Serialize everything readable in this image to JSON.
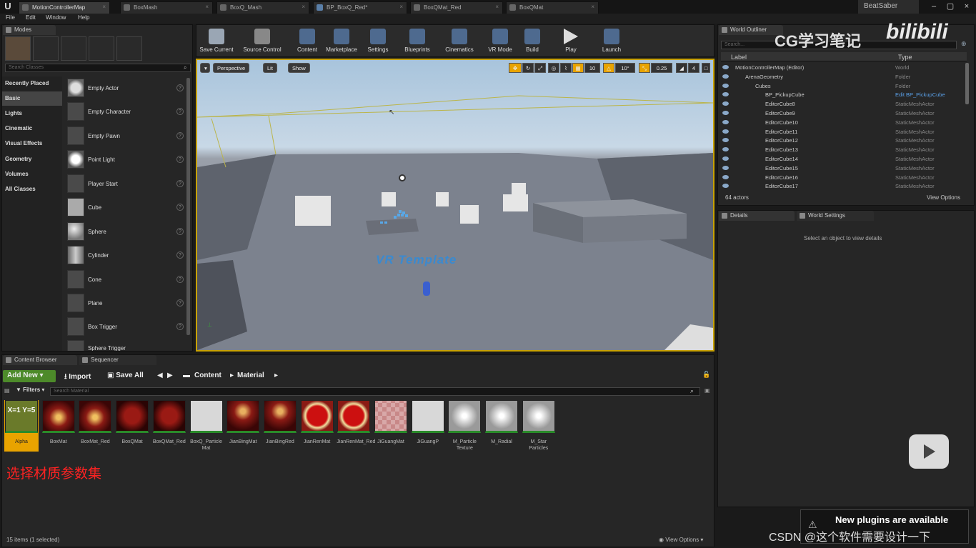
{
  "titlebar": {
    "tabs": [
      "MotionControllerMap",
      "BoxMash",
      "BoxQ_Mash",
      "BP_BoxQ_Red*",
      "BoxQMat_Red",
      "BoxQMat"
    ],
    "project": "BeatSaber"
  },
  "menu": [
    "File",
    "Edit",
    "Window",
    "Help"
  ],
  "modes": {
    "tab": "Modes",
    "search_placeholder": "Search Classes",
    "categories": [
      "Recently Placed",
      "Basic",
      "Lights",
      "Cinematic",
      "Visual Effects",
      "Geometry",
      "Volumes",
      "All Classes"
    ],
    "items": [
      "Empty Actor",
      "Empty Character",
      "Empty Pawn",
      "Point Light",
      "Player Start",
      "Cube",
      "Sphere",
      "Cylinder",
      "Cone",
      "Plane",
      "Box Trigger",
      "Sphere Trigger"
    ]
  },
  "toolbar": [
    "Save Current",
    "Source Control",
    "Content",
    "Marketplace",
    "Settings",
    "Blueprints",
    "Cinematics",
    "VR Mode",
    "Build",
    "Play",
    "Launch"
  ],
  "viewport": {
    "perspective": "Perspective",
    "lit": "Lit",
    "show": "Show",
    "grid": "10",
    "rot": "10°",
    "scale": "0.25",
    "cam": "4",
    "scene_text": "VR Template"
  },
  "outliner": {
    "tab": "World Outliner",
    "search_placeholder": "Search...",
    "col_label": "Label",
    "col_type": "Type",
    "rows": [
      {
        "label": "MotionControllerMap (Editor)",
        "type": "World",
        "indent": 0
      },
      {
        "label": "ArenaGeometry",
        "type": "Folder",
        "indent": 1
      },
      {
        "label": "Cubes",
        "type": "Folder",
        "indent": 2
      },
      {
        "label": "BP_PickupCube",
        "type": "Edit BP_PickupCube",
        "indent": 3
      },
      {
        "label": "EditorCube8",
        "type": "StaticMeshActor",
        "indent": 3
      },
      {
        "label": "EditorCube9",
        "type": "StaticMeshActor",
        "indent": 3
      },
      {
        "label": "EditorCube10",
        "type": "StaticMeshActor",
        "indent": 3
      },
      {
        "label": "EditorCube11",
        "type": "StaticMeshActor",
        "indent": 3
      },
      {
        "label": "EditorCube12",
        "type": "StaticMeshActor",
        "indent": 3
      },
      {
        "label": "EditorCube13",
        "type": "StaticMeshActor",
        "indent": 3
      },
      {
        "label": "EditorCube14",
        "type": "StaticMeshActor",
        "indent": 3
      },
      {
        "label": "EditorCube15",
        "type": "StaticMeshActor",
        "indent": 3
      },
      {
        "label": "EditorCube16",
        "type": "StaticMeshActor",
        "indent": 3
      },
      {
        "label": "EditorCube17",
        "type": "StaticMeshActor",
        "indent": 3
      }
    ],
    "count": "64 actors",
    "view_options": "View Options"
  },
  "details": {
    "tab": "Details",
    "tab2": "World Settings",
    "empty": "Select an object to view details"
  },
  "content_browser": {
    "tab": "Content Browser",
    "tab2": "Sequencer",
    "add_new": "Add New",
    "import": "Import",
    "save_all": "Save All",
    "path": [
      "Content",
      "Material"
    ],
    "filters": "Filters",
    "search_placeholder": "Search Material",
    "assets": [
      "Alpha",
      "BoxMat",
      "BoxMat_Red",
      "BoxQMat",
      "BoxQMat_Red",
      "BoxQ_Particle Mat",
      "JianBingMat",
      "JianBingRed",
      "JianRenMat",
      "JianRenMat_Red",
      "JiGuangMat",
      "JiGuangP",
      "M_Particle Texture",
      "M_Radial",
      "M_Star Particles"
    ],
    "alpha_label": "X=1 Y=5",
    "status": "15 items (1 selected)",
    "view_options": "View Options",
    "annotation": "选择材质参数集"
  },
  "overlays": {
    "watermark": "CG学习笔记",
    "notification": "New plugins are available",
    "csdn": "CSDN @这个软件需要设计一下"
  },
  "colors": {
    "accent": "#e8a300",
    "annotation": "#ff2222",
    "add_new": "#4d8a2a"
  }
}
